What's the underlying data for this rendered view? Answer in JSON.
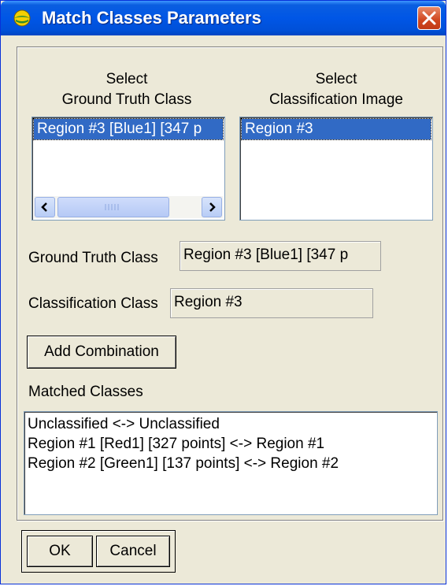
{
  "window": {
    "title": "Match Classes Parameters"
  },
  "ground_truth_list": {
    "header_line1": "Select",
    "header_line2": "Ground Truth Class",
    "items": [
      "Region #3 [Blue1] [347 p"
    ]
  },
  "classification_list": {
    "header_line1": "Select",
    "header_line2": "Classification Image",
    "items": [
      "Region #3"
    ]
  },
  "ground_truth_field": {
    "label": "Ground Truth Class",
    "value": "Region #3 [Blue1] [347 p"
  },
  "classification_field": {
    "label": "Classification Class",
    "value": "Region #3"
  },
  "add_combination_label": "Add Combination",
  "matched_classes": {
    "label": "Matched Classes",
    "items": [
      "Unclassified <-> Unclassified",
      "Region #1 [Red1] [327 points] <-> Region #1",
      "Region #2 [Green1] [137 points] <-> Region #2"
    ]
  },
  "buttons": {
    "ok": "OK",
    "cancel": "Cancel"
  },
  "colors": {
    "titlebar": "#0056e6",
    "selection": "#316ac5",
    "close": "#d0461f",
    "dialog_bg": "#ece9d8"
  },
  "icons": {
    "app": "envi-globe-icon",
    "close": "close-x-icon",
    "scroll_left": "arrow-left-icon",
    "scroll_right": "arrow-right-icon"
  }
}
